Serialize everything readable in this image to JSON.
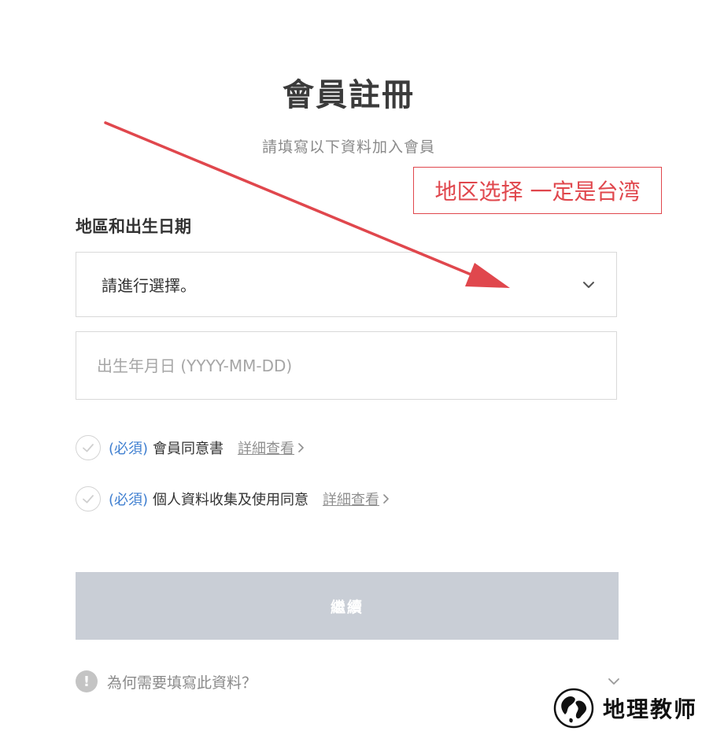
{
  "header": {
    "title": "會員註冊",
    "subtitle": "請填寫以下資料加入會員"
  },
  "form": {
    "section_label": "地區和出生日期",
    "region_select": {
      "selected": "請進行選擇。",
      "icon": "chevron-down-icon"
    },
    "birthdate": {
      "value": "",
      "placeholder": "出生年月日 (YYYY-MM-DD)"
    },
    "agreements": [
      {
        "required_tag": "(必須)",
        "label": "會員同意書",
        "link": "詳細查看"
      },
      {
        "required_tag": "(必須)",
        "label": "個人資料收集及使用同意",
        "link": "詳細查看"
      }
    ],
    "continue_label": "繼續",
    "why_text": "為何需要填寫此資料？"
  },
  "annotation": {
    "text": "地区选择 一定是台湾",
    "color": "#e0474d"
  },
  "watermark": {
    "text": "地理教师"
  },
  "colors": {
    "accent_blue": "#3f7fd0",
    "button_disabled": "#c9ced6",
    "annotation_red": "#e0474d"
  }
}
